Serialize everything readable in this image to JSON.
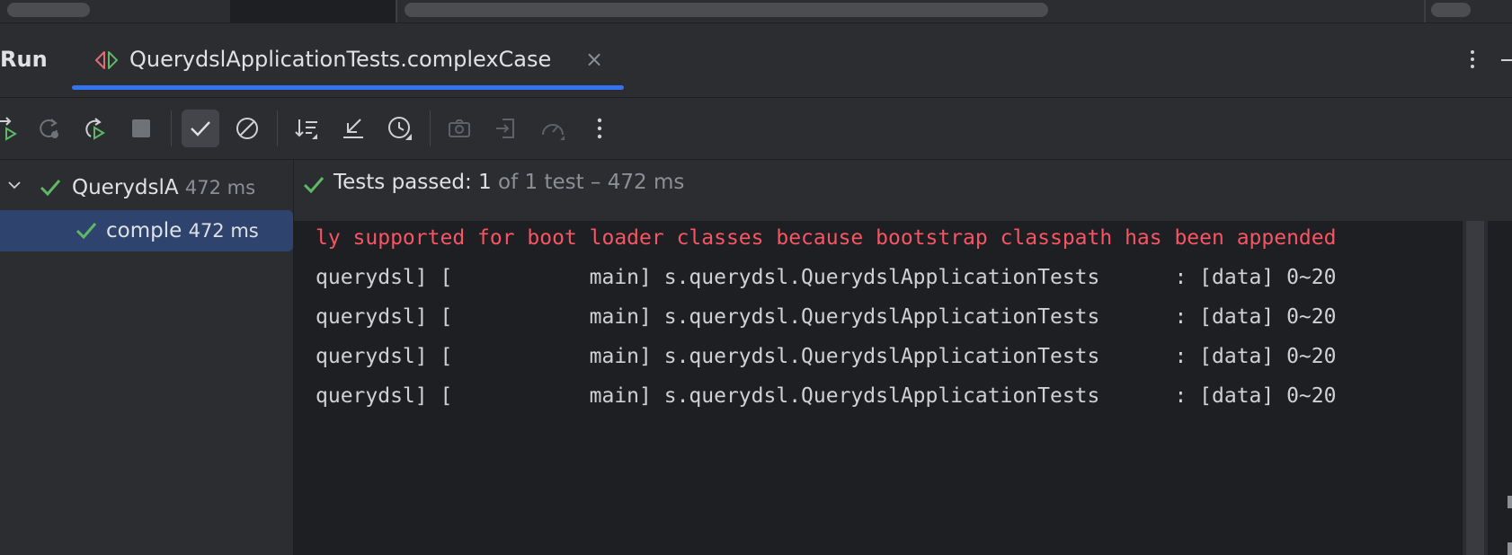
{
  "header": {
    "run_label": "Run",
    "tab": {
      "label": "QuerydslApplicationTests.complexCase",
      "close": "×"
    }
  },
  "toolbar": {
    "buttons": [
      {
        "name": "rerun-failed-button",
        "icon": "rerun-failed-icon"
      },
      {
        "name": "rerun-button",
        "icon": "rerun-icon"
      },
      {
        "name": "rerun-automatically-button",
        "icon": "rerun-auto-icon"
      },
      {
        "name": "stop-button",
        "icon": "stop-icon"
      },
      {
        "name": "show-passed-button",
        "icon": "check-icon",
        "active": true
      },
      {
        "name": "show-ignored-button",
        "icon": "ignored-icon"
      },
      {
        "name": "sort-button",
        "icon": "sort-icon"
      },
      {
        "name": "collapse-button",
        "icon": "collapse-icon"
      },
      {
        "name": "history-button",
        "icon": "history-icon"
      },
      {
        "name": "screenshot-button",
        "icon": "camera-icon"
      },
      {
        "name": "import-button",
        "icon": "import-icon"
      },
      {
        "name": "coverage-button",
        "icon": "gauge-icon"
      },
      {
        "name": "more-button",
        "icon": "more-vertical-icon"
      }
    ]
  },
  "tree": {
    "root": {
      "name": "QuerydslA",
      "time": "472 ms"
    },
    "child": {
      "name": "comple",
      "time": "472 ms"
    }
  },
  "status": {
    "prefix": "Tests passed: ",
    "count": "1",
    "suffix": " of 1 test – 472 ms"
  },
  "console": {
    "lines": [
      "ly supported for boot loader classes because bootstrap classpath has been appended",
      "querydsl] [           main] s.querydsl.QuerydslApplicationTests      : [data] 0~20",
      "querydsl] [           main] s.querydsl.QuerydslApplicationTests      : [data] 0~20",
      "querydsl] [           main] s.querydsl.QuerydslApplicationTests      : [data] 0~20",
      "querydsl] [           main] s.querydsl.QuerydslApplicationTests      : [data] 0~20"
    ]
  },
  "colors": {
    "accent": "#3574f0",
    "success": "#5fb865",
    "error": "#f75464",
    "panel": "#2b2d30",
    "editor": "#1e1f22"
  }
}
